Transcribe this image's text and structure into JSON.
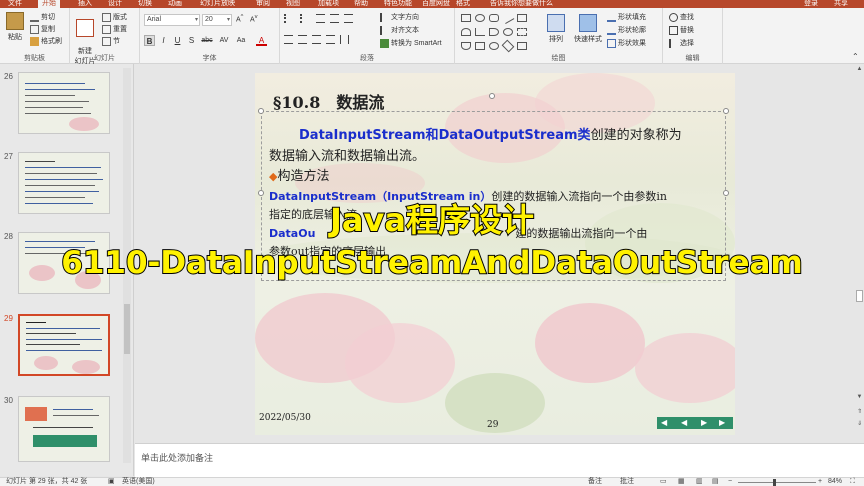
{
  "tabs": [
    "文件",
    "开始",
    "插入",
    "设计",
    "切换",
    "动画",
    "幻灯片放映",
    "审阅",
    "视图",
    "加载项",
    "帮助",
    "特色功能",
    "百度网盘",
    "格式",
    "告诉我你想要做什么",
    "登录",
    "共享"
  ],
  "ribbon": {
    "clipboard": {
      "paste": "粘贴",
      "cut": "剪切",
      "copy": "复制",
      "format_painter": "格式刷",
      "label": "剪贴板"
    },
    "slides": {
      "new_slide": "新建\n幻灯片",
      "layout": "版式",
      "reset": "重置",
      "section": "节",
      "label": "幻灯片"
    },
    "font": {
      "name": "Arial",
      "size": "20",
      "buttons": [
        "B",
        "I",
        "U",
        "S",
        "abc",
        "AV",
        "Aa",
        "A"
      ],
      "label": "字体"
    },
    "paragraph": {
      "text_direction": "文字方向",
      "align_text": "对齐文本",
      "smartart": "转换为 SmartArt",
      "label": "段落"
    },
    "drawing": {
      "arrange": "排列",
      "quick_styles": "快速样式",
      "fill": "形状填充",
      "outline": "形状轮廓",
      "effects": "形状效果",
      "label": "绘图"
    },
    "editing": {
      "find": "查找",
      "replace": "替换",
      "select": "选择",
      "label": "编辑"
    }
  },
  "thumbnails": [
    {
      "num": "26",
      "selected": false
    },
    {
      "num": "27",
      "selected": false
    },
    {
      "num": "28",
      "selected": false
    },
    {
      "num": "29",
      "selected": true
    },
    {
      "num": "30",
      "selected": false
    }
  ],
  "slide": {
    "title": "§10.8　数据流",
    "para1_blue_a": "DataInputStream",
    "para1_mid": "和",
    "para1_blue_b": "DataOutputStream",
    "para1_blue_c": "类",
    "para1_rest": "创建的对象称为",
    "para1_line2": "数据输入流和数据输出流。",
    "bullet": "◆",
    "bullet_text": "构造方法",
    "ctor1_blue": "DataInputStream（InputStream  in）",
    "ctor1_rest": "创建的数据输入流指向一个由参数in",
    "ctor1_line2": "指定的底层输入流",
    "ctor2_blue": "DataOu",
    "ctor2_rest": "建的数据输出流指向一个由",
    "ctor2_line2": "参数out指定的底层输出",
    "date": "2022/05/30",
    "page": "29"
  },
  "overlay": {
    "line1": "Java程序设计",
    "line2": "6110-DataInputStreamAndDataOutStream"
  },
  "notes_placeholder": "单击此处添加备注",
  "status": {
    "slide_info": "幻灯片 第 29 张，共 42 张",
    "language": "英语(美国)",
    "notes_btn": "备注",
    "comments_btn": "批注",
    "zoom": "84%"
  },
  "colors": {
    "accent": "#b7472a",
    "slide_blue": "#1a2ecc",
    "overlay_yellow": "#fff200",
    "nav_green": "#2f8f6a"
  }
}
